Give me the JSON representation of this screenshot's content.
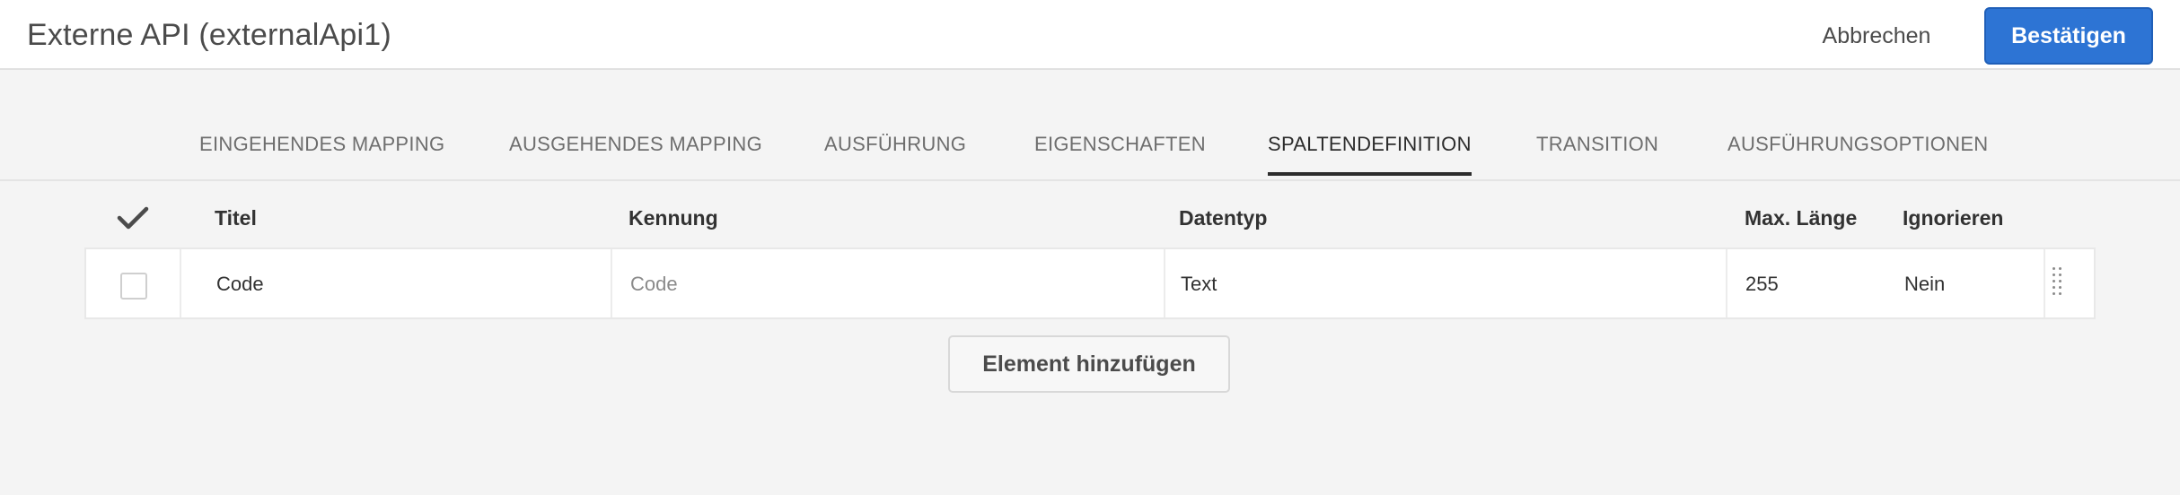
{
  "header": {
    "title": "Externe API (externalApi1)",
    "cancel_label": "Abbrechen",
    "confirm_label": "Bestätigen"
  },
  "tabs": [
    {
      "label": "EINGEHENDES MAPPING"
    },
    {
      "label": "AUSGEHENDES MAPPING"
    },
    {
      "label": "AUSFÜHRUNG"
    },
    {
      "label": "EIGENSCHAFTEN"
    },
    {
      "label": "SPALTENDEFINITION",
      "active": true
    },
    {
      "label": "TRANSITION"
    },
    {
      "label": "AUSFÜHRUNGSOPTIONEN"
    }
  ],
  "table": {
    "check_icon": "checkmark-icon",
    "columns": [
      "Titel",
      "Kennung",
      "Datentyp",
      "Max. Länge",
      "Ignorieren"
    ],
    "rows": [
      {
        "titel": "Code",
        "kennung_placeholder": "Code",
        "datentyp": "Text",
        "max_laenge": "255",
        "ignorieren": "Nein"
      }
    ]
  },
  "actions": {
    "add_element_label": "Element hinzufügen"
  },
  "colors": {
    "accent": "#2d74d4",
    "background": "#f4f4f4",
    "surface": "#ffffff"
  }
}
